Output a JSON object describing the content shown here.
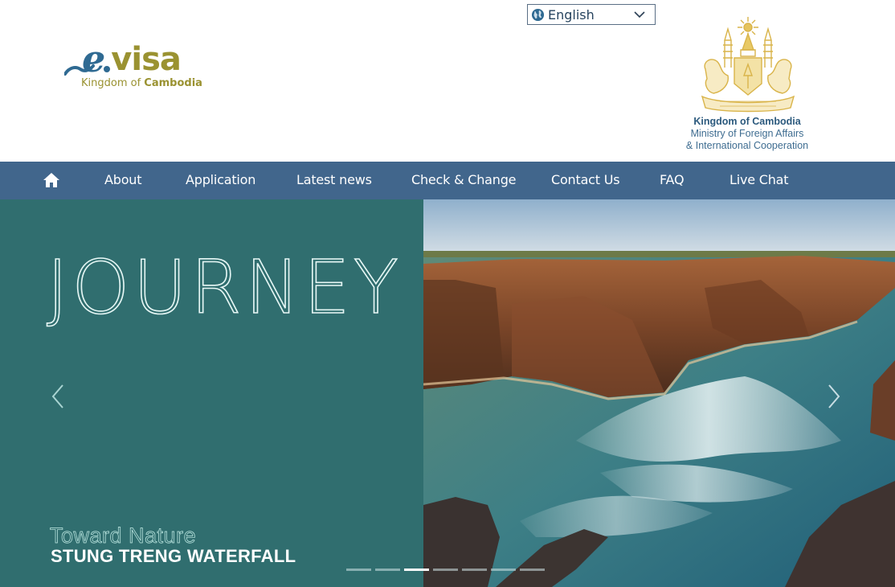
{
  "header": {
    "logo": {
      "mark_e": "e",
      "mark_visa": "visa",
      "subtitle_plain": "Kingdom of ",
      "subtitle_bold": "Cambodia"
    },
    "language": {
      "icon": "globe-icon",
      "selected": "English",
      "dropdown_icon": "chevron-down-icon"
    },
    "ministry": {
      "emblem_icon": "royal-coat-of-arms-icon",
      "line1": "Kingdom of Cambodia",
      "line2": "Ministry of Foreign Affairs",
      "line3": "& International Cooperation"
    }
  },
  "nav": {
    "home_icon": "home-icon",
    "items": [
      {
        "label": "About"
      },
      {
        "label": "Application"
      },
      {
        "label": "Latest news"
      },
      {
        "label": "Check & Change"
      },
      {
        "label": "Contact Us"
      },
      {
        "label": "FAQ"
      },
      {
        "label": "Live Chat"
      }
    ]
  },
  "hero": {
    "title": "JOURNEY",
    "subtitle": "Toward Nature",
    "location": "STUNG TRENG WATERFALL",
    "prev_icon": "chevron-left-icon",
    "next_icon": "chevron-right-icon",
    "slide_count": 7,
    "active_slide": 3
  },
  "colors": {
    "nav_bg": "#41668c",
    "hero_panel": "#306e6f",
    "brand_blue": "#2f6a92",
    "brand_olive": "#9a9231",
    "emblem_gold": "#d9b44a"
  }
}
